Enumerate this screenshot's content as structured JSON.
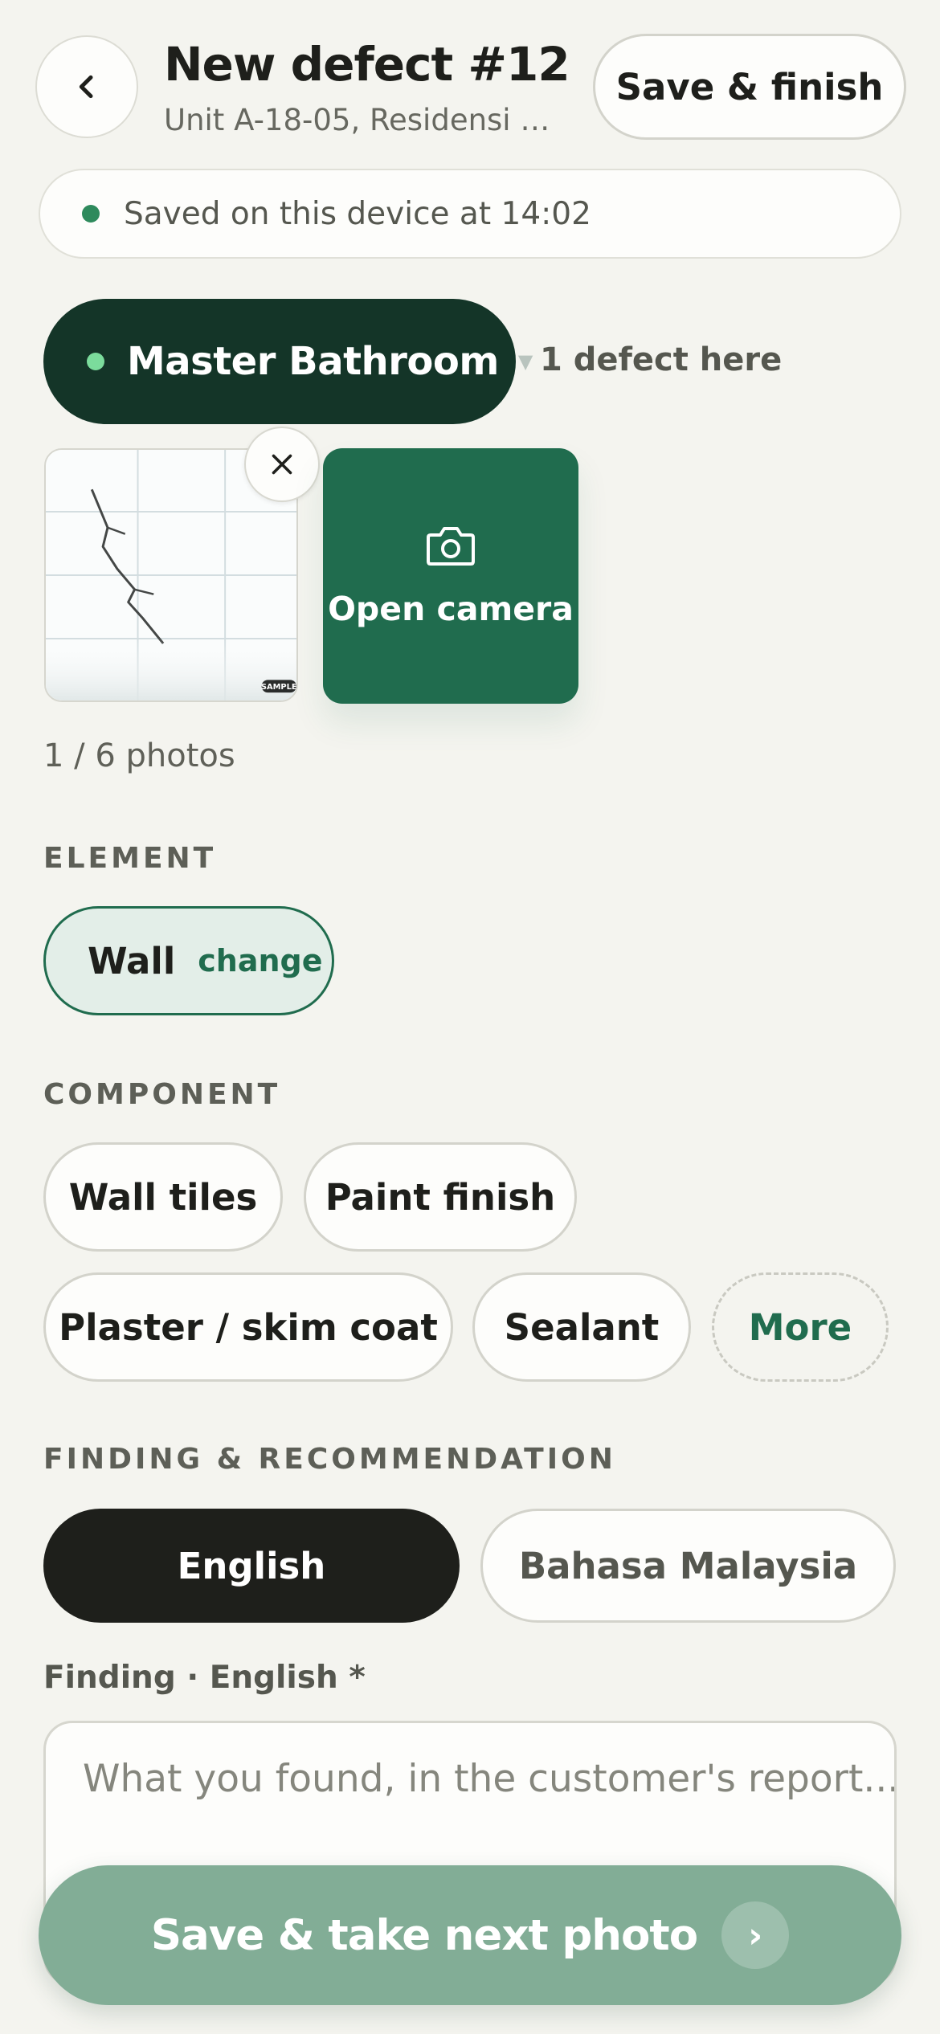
{
  "header": {
    "title": "New defect #12",
    "subtitle": "Unit A-18-05, Residensi M...",
    "finish_label": "Save & finish"
  },
  "status": {
    "saved_text": "Saved on this device at 14:02",
    "dot_color": "#2e8a5c"
  },
  "room": {
    "name": "Master Bathroom",
    "defect_count_text": "1 defect here"
  },
  "photos": {
    "count_text": "1 / 6 photos",
    "thumb_badge": "SAMPLE",
    "camera_label": "Open camera"
  },
  "element": {
    "section_label": "ELEMENT",
    "selected": "Wall",
    "change_label": "change"
  },
  "component": {
    "section_label": "COMPONENT",
    "options": [
      "Wall tiles",
      "Paint finish",
      "Plaster / skim coat",
      "Sealant"
    ],
    "more_label": "More"
  },
  "finding": {
    "section_label": "FINDING & RECOMMENDATION",
    "languages": [
      "English",
      "Bahasa Malaysia"
    ],
    "active_language": "English",
    "field_label": "Finding · English *",
    "placeholder": "What you found, in the customer's report..."
  },
  "actions": {
    "next_label": "Save & take next photo"
  },
  "colors": {
    "primary": "#206c4e",
    "dark_room": "#143528",
    "background": "#f4f4ef",
    "next_button": "#82ad96"
  }
}
